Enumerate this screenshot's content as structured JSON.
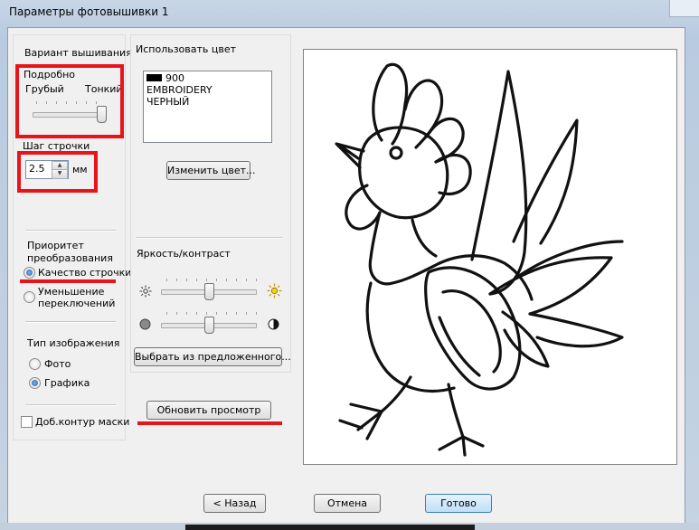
{
  "window": {
    "title": "Параметры фотовышивки 1"
  },
  "variant": {
    "group_label": "Вариант вышивания",
    "detail_label": "Подробно",
    "coarse_label": "Грубый",
    "fine_label": "Тонкий",
    "detail_level": 1.0
  },
  "stitch_step": {
    "label": "Шаг строчки",
    "value": "2.5",
    "unit": "мм"
  },
  "priority": {
    "label": "Приоритет преобразования",
    "options": [
      {
        "label": "Качество строчки",
        "selected": true
      },
      {
        "label": "Уменьшение переключений",
        "selected": false
      }
    ]
  },
  "image_type": {
    "label": "Тип изображения",
    "options": [
      {
        "label": "Фото",
        "selected": false
      },
      {
        "label": "Графика",
        "selected": true
      }
    ]
  },
  "mask_contour": {
    "label": "Доб.контур маски",
    "checked": false
  },
  "use_color": {
    "label": "Использовать цвет",
    "list": [
      "900",
      "EMBROIDERY",
      "ЧЕРНЫЙ"
    ],
    "swatch_color": "#000000",
    "change_button": "Изменить цвет..."
  },
  "brightness_contrast": {
    "label": "Яркость/контраст",
    "brightness_level": 0.5,
    "contrast_level": 0.5,
    "preset_button": "Выбрать из предложенного..."
  },
  "refresh_button": "Обновить просмотр",
  "footer": {
    "back": "< Назад",
    "cancel": "Отмена",
    "finish": "Готово"
  },
  "colors": {
    "annotation_red": "#e8141c",
    "accent_blue": "#3c7fb1"
  }
}
